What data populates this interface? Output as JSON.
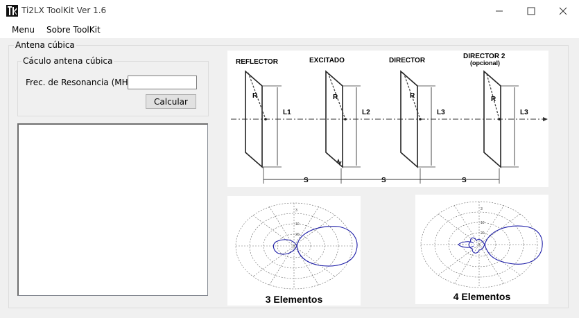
{
  "window": {
    "title": "Ti2LX ToolKit Ver 1.6",
    "minimize_symbol": "—",
    "maximize_symbol": "☐",
    "close_symbol": "✕"
  },
  "menu": {
    "items": [
      "Menu",
      "Sobre ToolKit"
    ]
  },
  "antenna_group": {
    "label": "Antena cúbica"
  },
  "calc_group": {
    "label": "Cáculo antena cúbica",
    "freq_label": "Frec. de Resonancia (MHz)",
    "freq_value": "",
    "calc_button": "Calcular"
  },
  "diagram": {
    "element_names": [
      "REFLECTOR",
      "EXCITADO",
      "DIRECTOR",
      "DIRECTOR 2"
    ],
    "optional_note": "(opcional)",
    "radius_label": "R",
    "lengths": [
      "L1",
      "L2",
      "L3",
      "L3"
    ],
    "spacing_label": "S"
  },
  "patterns": {
    "three_elements": "3 Elementos",
    "four_elements": "4 Elementos",
    "ring_labels": [
      "3",
      "10",
      "20"
    ]
  },
  "colors": {
    "pattern_line": "#1a1aa6",
    "grid_line": "#555555"
  }
}
